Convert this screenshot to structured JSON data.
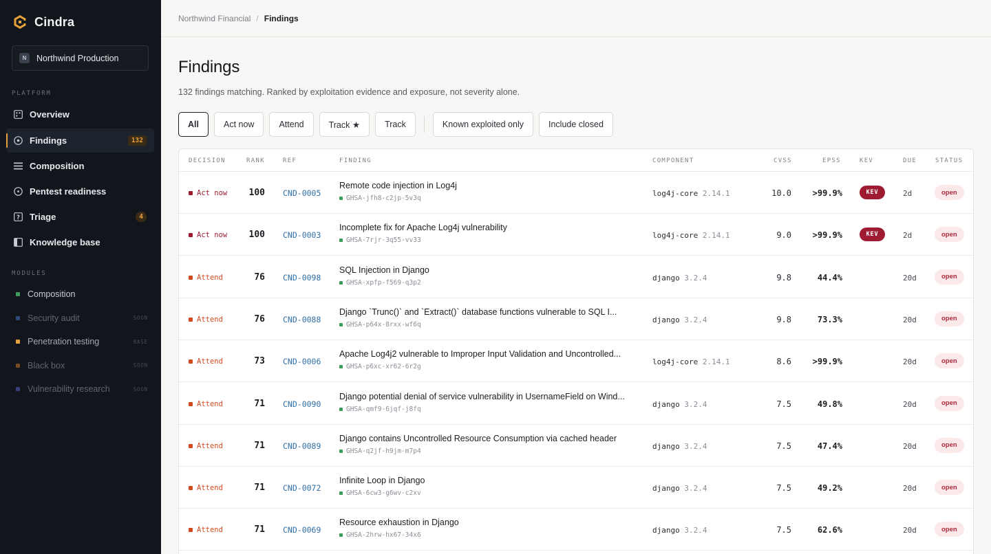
{
  "sidebar": {
    "brand": "Cindra",
    "workspace": {
      "initial": "N",
      "name": "Northwind Production"
    },
    "platform_label": "PLATFORM",
    "platform_items": [
      {
        "label": "Overview",
        "icon": "dashboard-icon",
        "badge": ""
      },
      {
        "label": "Findings",
        "icon": "target-icon",
        "badge": "132",
        "active": true
      },
      {
        "label": "Composition",
        "icon": "layers-icon",
        "badge": ""
      },
      {
        "label": "Pentest readiness",
        "icon": "radar-icon",
        "badge": ""
      },
      {
        "label": "Triage",
        "icon": "question-icon",
        "badge": "4"
      },
      {
        "label": "Knowledge base",
        "icon": "book-icon",
        "badge": ""
      }
    ],
    "modules_label": "MODULES",
    "modules": [
      {
        "label": "Composition",
        "tag": "",
        "dot": "#3b9b5c",
        "color": "#c9ccd2"
      },
      {
        "label": "Security audit",
        "tag": "SOON",
        "dot": "#2a4a7a",
        "color": "#5f6670"
      },
      {
        "label": "Penetration testing",
        "tag": "BASE",
        "dot": "#e8a23b",
        "color": "#a3a8b0"
      },
      {
        "label": "Black box",
        "tag": "SOON",
        "dot": "#7a4a22",
        "color": "#5f6670"
      },
      {
        "label": "Vulnerability research",
        "tag": "SOON",
        "dot": "#3a3f7a",
        "color": "#5f6670"
      }
    ]
  },
  "breadcrumb": {
    "parent": "Northwind Financial",
    "separator": "/",
    "current": "Findings"
  },
  "page": {
    "title": "Findings",
    "subtitle": "132 findings matching. Ranked by exploitation evidence and exposure, not severity alone."
  },
  "filters": {
    "decision": [
      "All",
      "Act now",
      "Attend",
      "Track ★",
      "Track"
    ],
    "toggles": [
      "Known exploited only",
      "Include closed"
    ]
  },
  "table": {
    "headers": {
      "decision": "DECISION",
      "rank": "RANK",
      "ref": "REF",
      "finding": "FINDING",
      "component": "COMPONENT",
      "cvss": "CVSS",
      "epss": "EPSS",
      "kev": "KEV",
      "due": "DUE",
      "status": "STATUS"
    },
    "rows": [
      {
        "decision": "Act now",
        "level": "act",
        "rank": "100",
        "ref": "CND-0005",
        "title": "Remote code injection in Log4j",
        "ghsa": "GHSA-jfh8-c2jp-5v3q",
        "component": "log4j-core",
        "version": "2.14.1",
        "cvss": "10.0",
        "epss": ">99.9%",
        "kev": "KEV",
        "due": "2d",
        "status": "open"
      },
      {
        "decision": "Act now",
        "level": "act",
        "rank": "100",
        "ref": "CND-0003",
        "title": "Incomplete fix for Apache Log4j vulnerability",
        "ghsa": "GHSA-7rjr-3q55-vv33",
        "component": "log4j-core",
        "version": "2.14.1",
        "cvss": "9.0",
        "epss": ">99.9%",
        "kev": "KEV",
        "due": "2d",
        "status": "open"
      },
      {
        "decision": "Attend",
        "level": "att",
        "rank": "76",
        "ref": "CND-0098",
        "title": "SQL Injection in Django",
        "ghsa": "GHSA-xpfp-f569-q3p2",
        "component": "django",
        "version": "3.2.4",
        "cvss": "9.8",
        "epss": "44.4%",
        "kev": "",
        "due": "20d",
        "status": "open"
      },
      {
        "decision": "Attend",
        "level": "att",
        "rank": "76",
        "ref": "CND-0088",
        "title": "Django `Trunc()` and `Extract()` database functions vulnerable to SQL I...",
        "ghsa": "GHSA-p64x-8rxx-wf6q",
        "component": "django",
        "version": "3.2.4",
        "cvss": "9.8",
        "epss": "73.3%",
        "kev": "",
        "due": "20d",
        "status": "open"
      },
      {
        "decision": "Attend",
        "level": "att",
        "rank": "73",
        "ref": "CND-0006",
        "title": "Apache Log4j2 vulnerable to Improper Input Validation and Uncontrolled...",
        "ghsa": "GHSA-p6xc-xr62-6r2g",
        "component": "log4j-core",
        "version": "2.14.1",
        "cvss": "8.6",
        "epss": ">99.9%",
        "kev": "",
        "due": "20d",
        "status": "open"
      },
      {
        "decision": "Attend",
        "level": "att",
        "rank": "71",
        "ref": "CND-0090",
        "title": "Django potential denial of service vulnerability in UsernameField on Wind...",
        "ghsa": "GHSA-qmf9-6jqf-j8fq",
        "component": "django",
        "version": "3.2.4",
        "cvss": "7.5",
        "epss": "49.8%",
        "kev": "",
        "due": "20d",
        "status": "open"
      },
      {
        "decision": "Attend",
        "level": "att",
        "rank": "71",
        "ref": "CND-0089",
        "title": "Django contains Uncontrolled Resource Consumption via cached header",
        "ghsa": "GHSA-q2jf-h9jm-m7p4",
        "component": "django",
        "version": "3.2.4",
        "cvss": "7.5",
        "epss": "47.4%",
        "kev": "",
        "due": "20d",
        "status": "open"
      },
      {
        "decision": "Attend",
        "level": "att",
        "rank": "71",
        "ref": "CND-0072",
        "title": "Infinite Loop in Django",
        "ghsa": "GHSA-6cw3-g6wv-c2xv",
        "component": "django",
        "version": "3.2.4",
        "cvss": "7.5",
        "epss": "49.2%",
        "kev": "",
        "due": "20d",
        "status": "open"
      },
      {
        "decision": "Attend",
        "level": "att",
        "rank": "71",
        "ref": "CND-0069",
        "title": "Resource exhaustion in Django",
        "ghsa": "GHSA-2hrw-hx67-34x6",
        "component": "django",
        "version": "3.2.4",
        "cvss": "7.5",
        "epss": "62.6%",
        "kev": "",
        "due": "20d",
        "status": "open"
      }
    ]
  }
}
